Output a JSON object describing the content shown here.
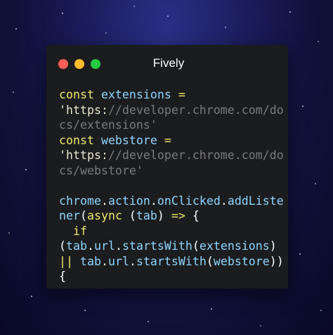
{
  "window": {
    "title": "Fively",
    "controls": {
      "close_color": "#ff5f57",
      "minimize_color": "#febc2e",
      "maximize_color": "#28c840"
    }
  },
  "code": {
    "lines": [
      [
        {
          "text": "const",
          "kind": "kw"
        },
        {
          "text": " ",
          "kind": "punct"
        },
        {
          "text": "extensions",
          "kind": "var"
        },
        {
          "text": " ",
          "kind": "punct"
        },
        {
          "text": "=",
          "kind": "op"
        }
      ],
      [
        {
          "text": "'https:",
          "kind": "str-bright"
        },
        {
          "text": "//developer.chrome.com/do",
          "kind": "str-dim"
        }
      ],
      [
        {
          "text": "cs/extensions'",
          "kind": "str-dim"
        }
      ],
      [
        {
          "text": "const",
          "kind": "kw"
        },
        {
          "text": " ",
          "kind": "punct"
        },
        {
          "text": "webstore",
          "kind": "var"
        },
        {
          "text": " ",
          "kind": "punct"
        },
        {
          "text": "=",
          "kind": "op"
        }
      ],
      [
        {
          "text": "'https:",
          "kind": "str-bright"
        },
        {
          "text": "//developer.chrome.com/do",
          "kind": "str-dim"
        }
      ],
      [
        {
          "text": "cs/webstore'",
          "kind": "str-dim"
        }
      ],
      [],
      [
        {
          "text": "chrome",
          "kind": "var"
        },
        {
          "text": ".",
          "kind": "punct"
        },
        {
          "text": "action",
          "kind": "var"
        },
        {
          "text": ".",
          "kind": "punct"
        },
        {
          "text": "onClicked",
          "kind": "var"
        },
        {
          "text": ".",
          "kind": "punct"
        },
        {
          "text": "addListe",
          "kind": "fn"
        }
      ],
      [
        {
          "text": "ner",
          "kind": "fn"
        },
        {
          "text": "(",
          "kind": "punct"
        },
        {
          "text": "async",
          "kind": "kw"
        },
        {
          "text": " (",
          "kind": "punct"
        },
        {
          "text": "tab",
          "kind": "var"
        },
        {
          "text": ") ",
          "kind": "punct"
        },
        {
          "text": "=>",
          "kind": "op"
        },
        {
          "text": " {",
          "kind": "punct"
        }
      ],
      [
        {
          "text": "  ",
          "kind": "punct"
        },
        {
          "text": "if",
          "kind": "kw"
        }
      ],
      [
        {
          "text": "(",
          "kind": "punct"
        },
        {
          "text": "tab",
          "kind": "var"
        },
        {
          "text": ".",
          "kind": "punct"
        },
        {
          "text": "url",
          "kind": "var"
        },
        {
          "text": ".",
          "kind": "punct"
        },
        {
          "text": "startsWith",
          "kind": "fn"
        },
        {
          "text": "(",
          "kind": "punct"
        },
        {
          "text": "extensions",
          "kind": "var"
        },
        {
          "text": ")",
          "kind": "punct"
        }
      ],
      [
        {
          "text": "||",
          "kind": "op"
        },
        {
          "text": " ",
          "kind": "punct"
        },
        {
          "text": "tab",
          "kind": "var"
        },
        {
          "text": ".",
          "kind": "punct"
        },
        {
          "text": "url",
          "kind": "var"
        },
        {
          "text": ".",
          "kind": "punct"
        },
        {
          "text": "startsWith",
          "kind": "fn"
        },
        {
          "text": "(",
          "kind": "punct"
        },
        {
          "text": "webstore",
          "kind": "var"
        },
        {
          "text": "))",
          "kind": "punct"
        }
      ],
      [
        {
          "text": "{",
          "kind": "punct"
        }
      ]
    ]
  },
  "colors": {
    "keyword": "#f1e96b",
    "identifier": "#8fd6ff",
    "string_prefix": "#eae7d0",
    "string_dim": "#7a7a7a",
    "window_bg": "#1b1c1e"
  }
}
